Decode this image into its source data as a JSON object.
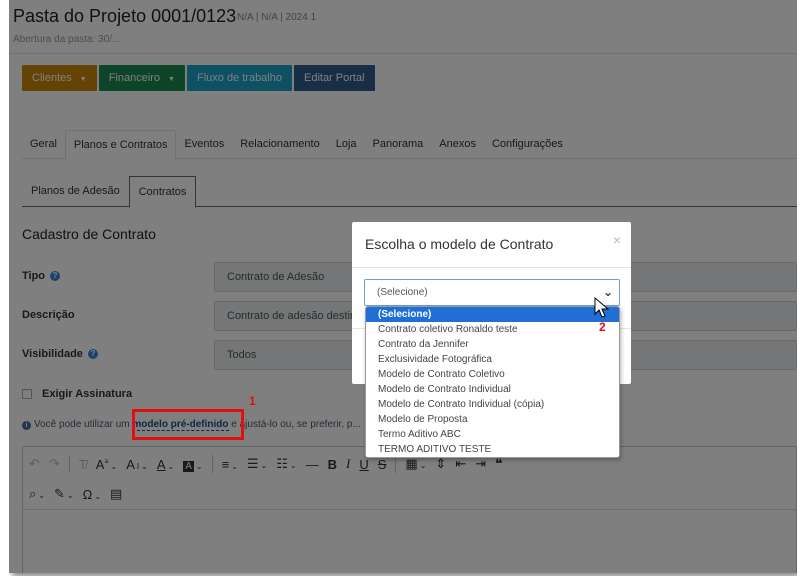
{
  "header": {
    "title": "Pasta do Projeto 0001/0123",
    "subtitle": "N/A | N/A | 2024 1",
    "note": "Abertura da pasta: 30/..."
  },
  "actions": [
    {
      "label": "Clientes",
      "color": "#c9860b",
      "caret": "▼"
    },
    {
      "label": "Financeiro",
      "color": "#198a4e",
      "caret": "▼"
    },
    {
      "label": "Fluxo de trabalho",
      "color": "#1aa3c7",
      "caret": ""
    },
    {
      "label": "Editar Portal",
      "color": "#2e5c8a",
      "caret": ""
    }
  ],
  "tabs": [
    "Geral",
    "Planos e Contratos",
    "Eventos",
    "Relacionamento",
    "Loja",
    "Panorama",
    "Anexos",
    "Configurações"
  ],
  "subtabs": [
    "Planos de Adesão",
    "Contratos"
  ],
  "form": {
    "section_title": "Cadastro de Contrato",
    "tipo_label": "Tipo",
    "tipo_value": "Contrato de Adesão",
    "descricao_label": "Descrição",
    "descricao_value": "Contrato de adesão destinado a ...",
    "visibilidade_label": "Visibilidade",
    "visibilidade_value": "Todos",
    "exigir_assinatura_label": "Exigir Assinatura",
    "info_prefix": "Você pode utilizar um ",
    "info_link": "modelo pré-definido",
    "info_suffix": " e ajustá-lo ou, se preferir, p..."
  },
  "annotations": {
    "first": "1",
    "second": "2"
  },
  "modal": {
    "title": "Escolha o modelo de Contrato",
    "close": "×",
    "select_value": "(Selecione)"
  },
  "dropdown_options": [
    "(Selecione)",
    "Contrato coletivo Ronaldo teste",
    "Contrato da Jennifer",
    "Exclusividade Fotográfica",
    "Modelo de Contrato Coletivo",
    "Modelo de Contrato Individual",
    "Modelo de Contrato Individual (cópia)",
    "Modelo de Proposta",
    "Termo Aditivo ABC",
    "TERMO ADITIVO TESTE"
  ],
  "colors": {
    "selected_option": "#1f6fd6",
    "annotation": "#e01010"
  }
}
